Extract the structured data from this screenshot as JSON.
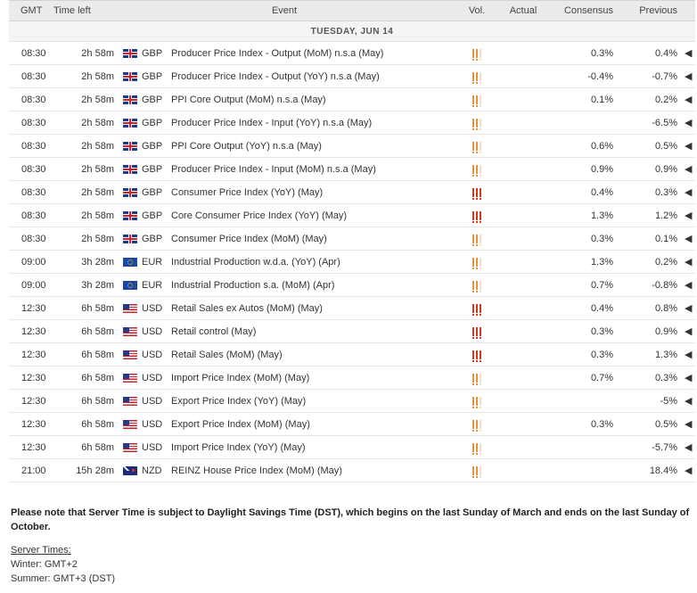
{
  "headers": {
    "gmt": "GMT",
    "time_left": "Time left",
    "event": "Event",
    "vol": "Vol.",
    "actual": "Actual",
    "consensus": "Consensus",
    "previous": "Previous"
  },
  "day_label": "TUESDAY, JUN 14",
  "volatility_colors": {
    "high": "#d03a21",
    "medium": "#e6913c",
    "low": "#f0dcc8"
  },
  "rows": [
    {
      "gmt": "08:30",
      "time_left": "2h 58m",
      "flag": "uk-flag-icon",
      "currency": "GBP",
      "event": "Producer Price Index - Output (MoM) n.s.a (May)",
      "vol": "medium",
      "actual": "",
      "consensus": "0.3%",
      "previous": "0.4%"
    },
    {
      "gmt": "08:30",
      "time_left": "2h 58m",
      "flag": "uk-flag-icon",
      "currency": "GBP",
      "event": "Producer Price Index - Output (YoY) n.s.a (May)",
      "vol": "medium",
      "actual": "",
      "consensus": "-0.4%",
      "previous": "-0.7%"
    },
    {
      "gmt": "08:30",
      "time_left": "2h 58m",
      "flag": "uk-flag-icon",
      "currency": "GBP",
      "event": "PPI Core Output (MoM) n.s.a (May)",
      "vol": "medium",
      "actual": "",
      "consensus": "0.1%",
      "previous": "0.2%"
    },
    {
      "gmt": "08:30",
      "time_left": "2h 58m",
      "flag": "uk-flag-icon",
      "currency": "GBP",
      "event": "Producer Price Index - Input (YoY) n.s.a (May)",
      "vol": "medium",
      "actual": "",
      "consensus": "",
      "previous": "-6.5%"
    },
    {
      "gmt": "08:30",
      "time_left": "2h 58m",
      "flag": "uk-flag-icon",
      "currency": "GBP",
      "event": "PPI Core Output (YoY) n.s.a (May)",
      "vol": "medium",
      "actual": "",
      "consensus": "0.6%",
      "previous": "0.5%"
    },
    {
      "gmt": "08:30",
      "time_left": "2h 58m",
      "flag": "uk-flag-icon",
      "currency": "GBP",
      "event": "Producer Price Index - Input (MoM) n.s.a (May)",
      "vol": "medium",
      "actual": "",
      "consensus": "0.9%",
      "previous": "0.9%"
    },
    {
      "gmt": "08:30",
      "time_left": "2h 58m",
      "flag": "uk-flag-icon",
      "currency": "GBP",
      "event": "Consumer Price Index (YoY) (May)",
      "vol": "high",
      "actual": "",
      "consensus": "0.4%",
      "previous": "0.3%"
    },
    {
      "gmt": "08:30",
      "time_left": "2h 58m",
      "flag": "uk-flag-icon",
      "currency": "GBP",
      "event": "Core Consumer Price Index (YoY) (May)",
      "vol": "high",
      "actual": "",
      "consensus": "1.3%",
      "previous": "1.2%"
    },
    {
      "gmt": "08:30",
      "time_left": "2h 58m",
      "flag": "uk-flag-icon",
      "currency": "GBP",
      "event": "Consumer Price Index (MoM) (May)",
      "vol": "medium",
      "actual": "",
      "consensus": "0.3%",
      "previous": "0.1%"
    },
    {
      "gmt": "09:00",
      "time_left": "3h 28m",
      "flag": "eu-flag-icon",
      "currency": "EUR",
      "event": "Industrial Production w.d.a. (YoY) (Apr)",
      "vol": "medium",
      "actual": "",
      "consensus": "1.3%",
      "previous": "0.2%"
    },
    {
      "gmt": "09:00",
      "time_left": "3h 28m",
      "flag": "eu-flag-icon",
      "currency": "EUR",
      "event": "Industrial Production s.a. (MoM) (Apr)",
      "vol": "medium",
      "actual": "",
      "consensus": "0.7%",
      "previous": "-0.8%"
    },
    {
      "gmt": "12:30",
      "time_left": "6h 58m",
      "flag": "us-flag-icon",
      "currency": "USD",
      "event": "Retail Sales ex Autos (MoM) (May)",
      "vol": "high",
      "actual": "",
      "consensus": "0.4%",
      "previous": "0.8%"
    },
    {
      "gmt": "12:30",
      "time_left": "6h 58m",
      "flag": "us-flag-icon",
      "currency": "USD",
      "event": "Retail control (May)",
      "vol": "high",
      "actual": "",
      "consensus": "0.3%",
      "previous": "0.9%"
    },
    {
      "gmt": "12:30",
      "time_left": "6h 58m",
      "flag": "us-flag-icon",
      "currency": "USD",
      "event": "Retail Sales (MoM) (May)",
      "vol": "high",
      "actual": "",
      "consensus": "0.3%",
      "previous": "1.3%"
    },
    {
      "gmt": "12:30",
      "time_left": "6h 58m",
      "flag": "us-flag-icon",
      "currency": "USD",
      "event": "Import Price Index (MoM) (May)",
      "vol": "medium",
      "actual": "",
      "consensus": "0.7%",
      "previous": "0.3%"
    },
    {
      "gmt": "12:30",
      "time_left": "6h 58m",
      "flag": "us-flag-icon",
      "currency": "USD",
      "event": "Export Price Index (YoY) (May)",
      "vol": "medium",
      "actual": "",
      "consensus": "",
      "previous": "-5%"
    },
    {
      "gmt": "12:30",
      "time_left": "6h 58m",
      "flag": "us-flag-icon",
      "currency": "USD",
      "event": "Export Price Index (MoM) (May)",
      "vol": "medium",
      "actual": "",
      "consensus": "0.3%",
      "previous": "0.5%"
    },
    {
      "gmt": "12:30",
      "time_left": "6h 58m",
      "flag": "us-flag-icon",
      "currency": "USD",
      "event": "Import Price Index (YoY) (May)",
      "vol": "medium",
      "actual": "",
      "consensus": "",
      "previous": "-5.7%"
    },
    {
      "gmt": "21:00",
      "time_left": "15h 28m",
      "flag": "nz-flag-icon",
      "currency": "NZD",
      "event": "REINZ House Price Index (MoM) (May)",
      "vol": "medium",
      "actual": "",
      "consensus": "",
      "previous": "18.4%"
    }
  ],
  "note": "Please note that Server Time is subject to Daylight Savings Time (DST), which begins on the last Sunday of March and ends on the last Sunday of October.",
  "server": {
    "title": "Server Times:",
    "winter": "Winter: GMT+2",
    "summer": "Summer: GMT+3 (DST)"
  }
}
